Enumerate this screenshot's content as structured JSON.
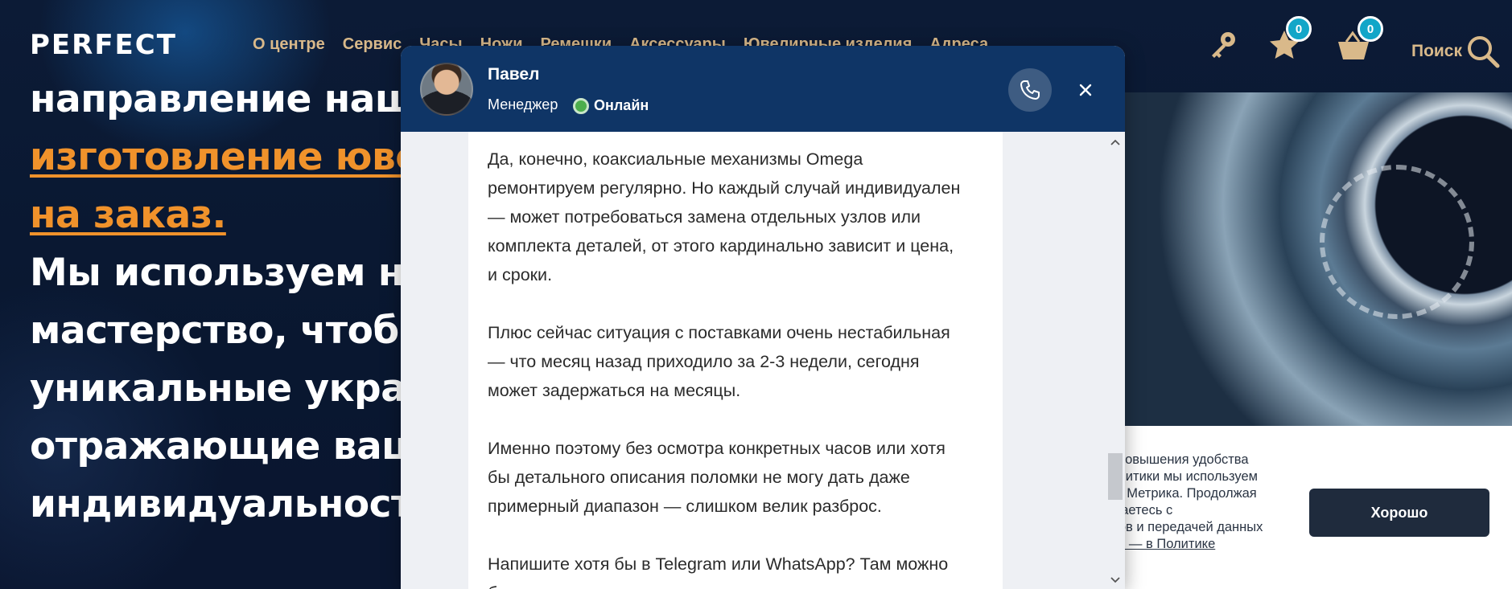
{
  "header": {
    "logo": "PERFECT",
    "nav": [
      "О центре",
      "Сервис",
      "Часы",
      "Ножи",
      "Ремешки",
      "Аксессуары",
      "Ювелирные изделия",
      "Адреса"
    ],
    "favorites_count": "0",
    "cart_count": "0",
    "search_label": "Поиск"
  },
  "hero": {
    "lines": [
      {
        "text": "направление наше",
        "accent": false
      },
      {
        "text": "изготовление юве",
        "accent": true
      },
      {
        "text": "на заказ.",
        "accent": true
      },
      {
        "text": "Мы используем на",
        "accent": false
      },
      {
        "text": "мастерство, чтобы",
        "accent": false
      },
      {
        "text": "уникальные украш",
        "accent": false
      },
      {
        "text": "отражающие вашу",
        "accent": false
      },
      {
        "text": "индивидуальность",
        "accent": false
      }
    ]
  },
  "chat": {
    "agent_name": "Павел",
    "agent_role": "Менеджер",
    "status": "Онлайн",
    "message_paragraphs": [
      [
        "Да, конечно, коаксиальные механизмы Omega",
        "ремонтируем регулярно. Но каждый случай индивидуален",
        "— может потребоваться замена отдельных узлов или",
        "комплекта деталей, от этого кардинально зависит и цена,",
        "и сроки."
      ],
      [
        "Плюс сейчас ситуация с поставками очень нестабильная",
        "— что месяц назад приходило за 2-3 недели, сегодня",
        "может задержаться на месяцы."
      ],
      [
        "Именно поэтому без осмотра конкретных часов или хотя",
        "бы детального описания поломки не могу дать даже",
        "примерный диапазон — слишком велик разброс."
      ],
      [
        "Напишите хотя бы в Telegram или WhatsApp? Там можно",
        "быстрее получить предварительную оценку от мастеров"
      ]
    ]
  },
  "cookie": {
    "lines": [
      ", повышения удобства",
      "алитики мы используем",
      "кс Метрика. Продолжая",
      "шаетесь с",
      "лов и передачей данных"
    ],
    "link": "ее — в Политике",
    "button": "Хорошо"
  },
  "colors": {
    "page_bg": "#0b1a34",
    "nav_text": "#d9b98a",
    "accent_orange": "#f0922b",
    "chat_header": "#0f3566",
    "badge": "#12a6c8",
    "cookie_button": "#1f2b3d"
  },
  "icons": [
    "key-icon",
    "star-icon",
    "basket-icon",
    "search-icon",
    "phone-icon",
    "close-icon",
    "chevron-up-icon",
    "chevron-down-icon"
  ]
}
